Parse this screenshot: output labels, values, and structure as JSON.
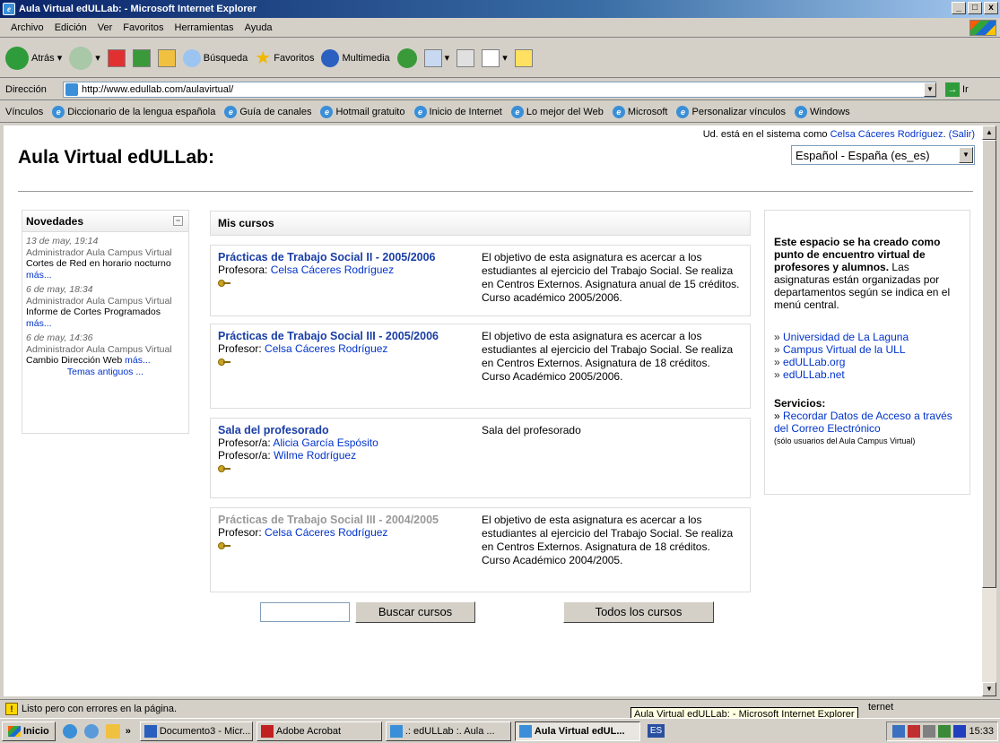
{
  "window": {
    "title": "Aula Virtual edULLab: - Microsoft Internet Explorer",
    "controls": [
      "_",
      "□",
      "x"
    ]
  },
  "menu": [
    "Archivo",
    "Edición",
    "Ver",
    "Favoritos",
    "Herramientas",
    "Ayuda"
  ],
  "toolbar": {
    "back": "Atrás",
    "search": "Búsqueda",
    "favorites": "Favoritos",
    "multimedia": "Multimedia"
  },
  "address": {
    "label": "Dirección",
    "url": "http://www.edullab.com/aulavirtual/",
    "go": "Ir"
  },
  "links": {
    "label": "Vínculos",
    "items": [
      "Diccionario de la lengua española",
      "Guía de canales",
      "Hotmail gratuito",
      "Inicio de Internet",
      "Lo mejor del Web",
      "Microsoft",
      "Personalizar vínculos",
      "Windows"
    ]
  },
  "page": {
    "site_title": "Aula Virtual edULLab:",
    "login_prefix": "Ud. está en el sistema como",
    "login_user": "Celsa Cáceres Rodríguez",
    "login_logout": "(Salir)",
    "language": "Español - España (es_es)"
  },
  "news": {
    "title": "Novedades",
    "items": [
      {
        "date": "13 de may, 19:14",
        "author": "Administrador Aula Campus Virtual",
        "text": "Cortes de Red en horario nocturno",
        "more": "más..."
      },
      {
        "date": "6 de may, 18:34",
        "author": "Administrador Aula Campus Virtual",
        "text": "Informe de Cortes Programados",
        "more": "más..."
      },
      {
        "date": "6 de may, 14:36",
        "author": "Administrador Aula Campus Virtual",
        "text": "Cambio Dirección Web",
        "more": "más..."
      }
    ],
    "older": "Temas antiguos ..."
  },
  "courses": {
    "title": "Mis cursos",
    "items": [
      {
        "name": "Prácticas de Trabajo Social II - 2005/2006",
        "teachers": [
          {
            "role": "Profesora:",
            "name": "Celsa Cáceres Rodríguez"
          }
        ],
        "desc": "El objetivo de esta asignatura es acercar a los estudiantes al ejercicio del Trabajo Social. Se realiza en Centros Externos. Asignatura anual de 15 créditos. Curso académico 2005/2006."
      },
      {
        "name": "Prácticas de Trabajo Social III - 2005/2006",
        "teachers": [
          {
            "role": "Profesor:",
            "name": "Celsa Cáceres Rodríguez"
          }
        ],
        "desc": "El objetivo de esta asignatura es acercar a los estudiantes al ejercicio del Trabajo Social. Se realiza en Centros Externos. Asignatura de 18 créditos.",
        "desc2": "Curso Académico 2005/2006."
      },
      {
        "name": "Sala del profesorado",
        "teachers": [
          {
            "role": "Profesor/a:",
            "name": "Alicia García Espósito"
          },
          {
            "role": "Profesor/a:",
            "name": "Wilme Rodríguez"
          }
        ],
        "desc": "Sala del profesorado"
      },
      {
        "name": "Prácticas de Trabajo Social III - 2004/2005",
        "teachers": [
          {
            "role": "Profesor:",
            "name": "Celsa Cáceres Rodríguez"
          }
        ],
        "desc": "El objetivo de esta asignatura es acercar a los estudiantes al ejercicio del Trabajo Social. Se realiza en Centros Externos. Asignatura de 18 créditos.",
        "desc2": "Curso Académico 2004/2005."
      }
    ],
    "search_button": "Buscar cursos",
    "all_button": "Todos los cursos"
  },
  "side": {
    "intro_bold": "Este espacio se ha creado como punto de encuentro virtual de profesores y alumnos.",
    "intro_rest": "Las asignaturas están organizadas por departamentos según se indica en el menú central.",
    "links": [
      "Universidad de La Laguna",
      "Campus Virtual de la ULL",
      "edULLab.org",
      "edULLab.net"
    ],
    "services_title": "Servicios:",
    "service_link": "Recordar Datos de Acceso a través del Correo Electrónico",
    "service_note": "(sólo usuarios del Aula Campus Virtual)"
  },
  "status": {
    "text": "Listo pero con errores en la página.",
    "tooltip": "Aula Virtual edULLab: - Microsoft Internet Explorer",
    "zone": "ternet"
  },
  "taskbar": {
    "start": "Inicio",
    "chevron": "»",
    "tasks": [
      "Documento3 - Micr...",
      "Adobe Acrobat",
      ".: edULLab :. Aula ...",
      "Aula Virtual edUL..."
    ],
    "lang": "ES",
    "clock": "15:33"
  }
}
